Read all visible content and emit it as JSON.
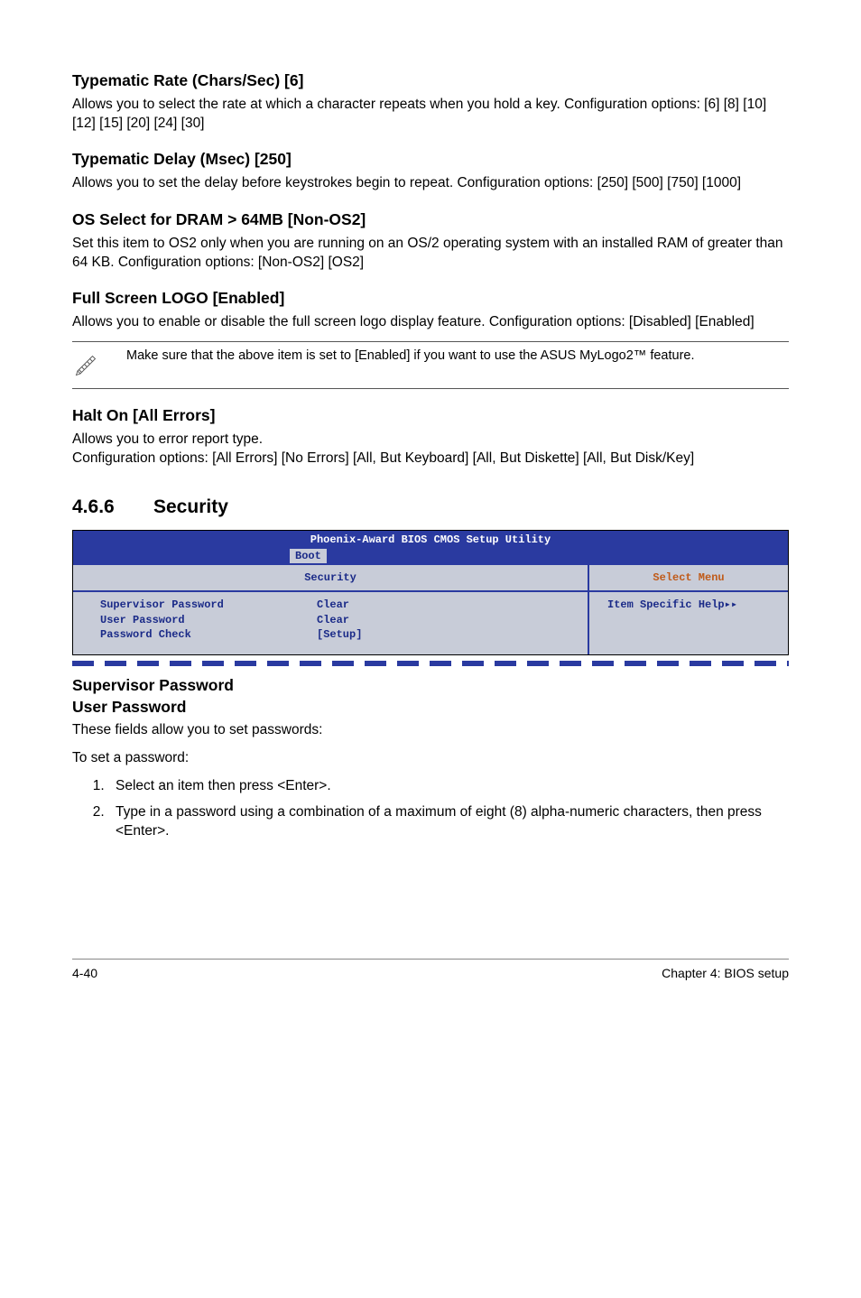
{
  "s1": {
    "title": "Typematic Rate (Chars/Sec) [6]",
    "body": "Allows you to select the rate at which a character repeats when you hold a key. Configuration options: [6] [8] [10] [12] [15] [20] [24] [30]"
  },
  "s2": {
    "title": "Typematic Delay (Msec) [250]",
    "body": "Allows you to set the delay before keystrokes begin to repeat. Configuration options: [250] [500] [750] [1000]"
  },
  "s3": {
    "title": "OS Select for DRAM > 64MB [Non-OS2]",
    "body": "Set this item to OS2 only when you are running on an OS/2 operating system with an installed RAM of greater than 64 KB. Configuration options: [Non-OS2] [OS2]"
  },
  "s4": {
    "title": "Full Screen LOGO [Enabled]",
    "body": "Allows you to enable or disable the full screen logo display feature. Configuration options: [Disabled] [Enabled]"
  },
  "note": {
    "text": "Make sure that the above item is set to [Enabled] if you want to use the ASUS MyLogo2™ feature."
  },
  "s5": {
    "title": "Halt On [All Errors]",
    "line1": "Allows you to error report type.",
    "line2": "Configuration options: [All Errors] [No Errors] [All, But Keyboard] [All, But Diskette] [All, But Disk/Key]"
  },
  "section": {
    "num": "4.6.6",
    "title": "Security"
  },
  "bios": {
    "title": "Phoenix-Award BIOS CMOS Setup Utility",
    "tab": "Boot",
    "left_head": "Security",
    "right_head": "Select Menu",
    "right_body": "Item Specific Help▸▸",
    "rows": [
      {
        "label": "Supervisor Password",
        "value": "Clear"
      },
      {
        "label": "User Password",
        "value": "Clear"
      },
      {
        "label": "Password Check",
        "value": "[Setup]"
      }
    ]
  },
  "pw": {
    "title1": "Supervisor Password",
    "title2": "User Password",
    "intro": "These fields allow you to set passwords:",
    "toset": "To set a password:",
    "step1": "Select an item then press <Enter>.",
    "step2": "Type in a password using a combination of a maximum of eight (8) alpha-numeric characters, then press <Enter>."
  },
  "footer": {
    "left": "4-40",
    "right": "Chapter 4: BIOS setup"
  }
}
